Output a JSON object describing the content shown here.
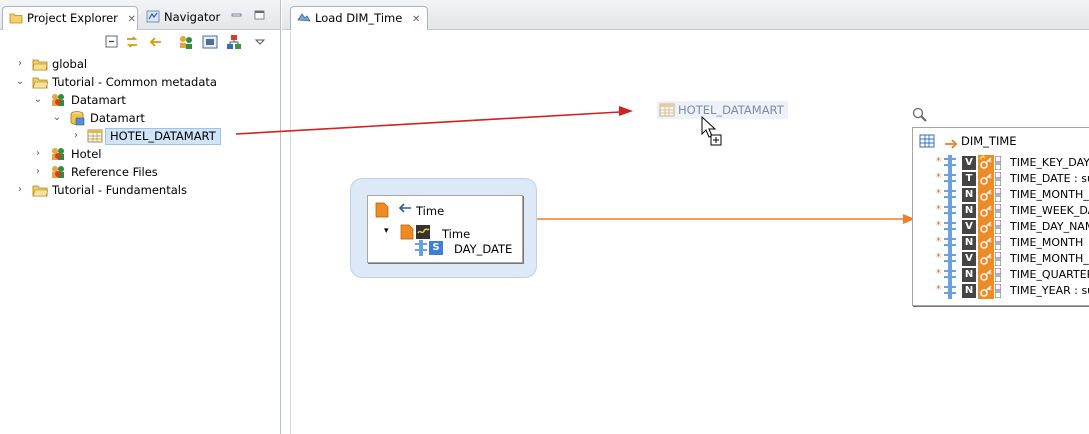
{
  "left_panel": {
    "tabs": [
      {
        "label": "Project Explorer",
        "close": "✕"
      },
      {
        "label": "Navigator"
      }
    ],
    "tree": [
      {
        "label": "global",
        "twisty": "›"
      },
      {
        "label": "Tutorial - Common metadata",
        "twisty": "⌄"
      },
      {
        "label": "Datamart",
        "twisty": "⌄"
      },
      {
        "label": "Datamart",
        "twisty": "⌄"
      },
      {
        "label": "HOTEL_DATAMART",
        "twisty": "›"
      },
      {
        "label": "Hotel",
        "twisty": "›"
      },
      {
        "label": "Reference Files",
        "twisty": "›"
      },
      {
        "label": "Tutorial - Fundamentals",
        "twisty": "›"
      }
    ]
  },
  "editor": {
    "tab": {
      "label": "Load DIM_Time",
      "close": "✕"
    },
    "drag_ghost_label": "HOTEL_DATAMART",
    "time_component": {
      "title": "Time",
      "child": "Time",
      "field": "DAY_DATE",
      "field_type": "S"
    },
    "dim_table": {
      "title": "DIM_TIME",
      "rows": [
        {
          "type": "V",
          "label": "TIME_KEY_DAY"
        },
        {
          "type": "T",
          "label": "TIME_DATE : su"
        },
        {
          "type": "N",
          "label": "TIME_MONTH_"
        },
        {
          "type": "N",
          "label": "TIME_WEEK_DA"
        },
        {
          "type": "V",
          "label": "TIME_DAY_NAM"
        },
        {
          "type": "N",
          "label": "TIME_MONTH"
        },
        {
          "type": "V",
          "label": "TIME_MONTH_"
        },
        {
          "type": "N",
          "label": "TIME_QUARTER"
        },
        {
          "type": "N",
          "label": "TIME_YEAR : su"
        }
      ]
    }
  },
  "colors": {
    "drag_arrow": "#d42020",
    "flow_arrow": "#f07d2a",
    "selection": "#cfe4f7"
  }
}
